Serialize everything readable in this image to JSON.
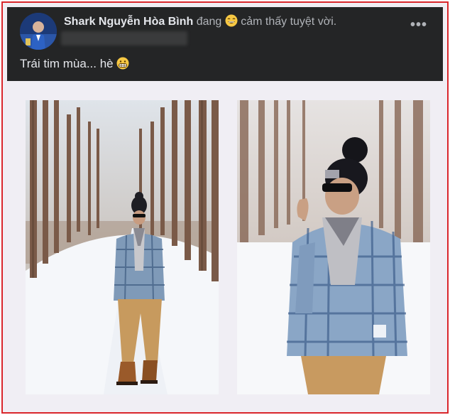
{
  "post": {
    "author": "Shark Nguyễn Hòa Bình",
    "feeling_prefix": "đang",
    "feeling": "cảm thấy tuyệt vời.",
    "caption": "Trái tim mùa... hè",
    "feeling_emoji": "grinning-face-icon",
    "caption_emoji": "grimacing-face-icon",
    "more_icon": "more-options-icon",
    "more_label": "•••"
  },
  "colors": {
    "header_bg": "#242526",
    "frame_border": "#d9262b",
    "page_bg": "#f0eef4",
    "author_text": "#e4e6eb",
    "muted_text": "#b0b3b8"
  },
  "photos": [
    {
      "name": "snow-forest-photo-full-body"
    },
    {
      "name": "snow-forest-photo-closeup"
    }
  ]
}
